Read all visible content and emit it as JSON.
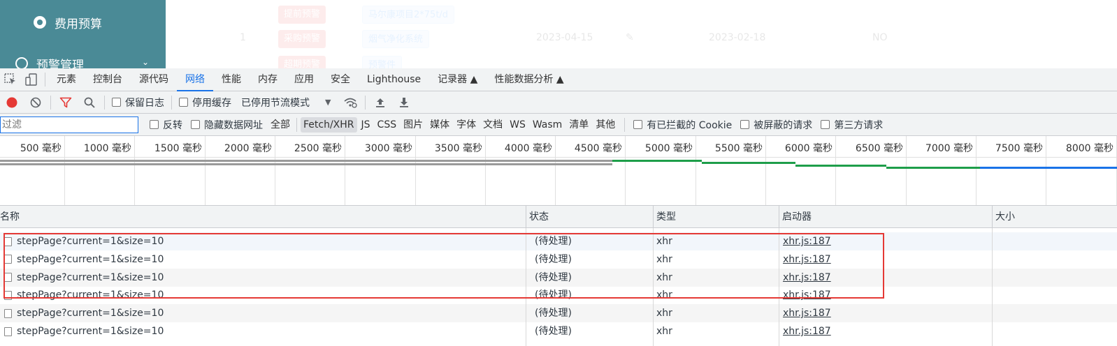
{
  "app": {
    "sidebar": {
      "budget_label": "费用预算",
      "warning_label": "预警管理",
      "chevron": "⌄"
    },
    "faded_row": {
      "tags_red": [
        "提前预警",
        "采购预警",
        "超期预警"
      ],
      "tags_blue": [
        "马尔康项目2*75t/d",
        "烟气净化系统",
        "预警件"
      ],
      "index": "1",
      "date1": "2023-04-15",
      "date2": "2023-02-18",
      "status": "NO"
    }
  },
  "devtools": {
    "tabs": [
      {
        "label": "元素"
      },
      {
        "label": "控制台"
      },
      {
        "label": "源代码"
      },
      {
        "label": "网络",
        "active": true
      },
      {
        "label": "性能"
      },
      {
        "label": "内存"
      },
      {
        "label": "应用"
      },
      {
        "label": "安全"
      },
      {
        "label": "Lighthouse"
      },
      {
        "label": "记录器 ▲"
      },
      {
        "label": "性能数据分析 ▲"
      }
    ],
    "toolbar": {
      "preserve_log": "保留日志",
      "disable_cache": "停用缓存",
      "throttling": "已停用节流模式",
      "throttling_arrow": "▼"
    },
    "filter": {
      "placeholder": "过滤",
      "invert": "反转",
      "hide_data_urls": "隐藏数据网址",
      "types": [
        "全部",
        "Fetch/XHR",
        "JS",
        "CSS",
        "图片",
        "媒体",
        "字体",
        "文档",
        "WS",
        "Wasm",
        "清单",
        "其他"
      ],
      "active_type": "Fetch/XHR",
      "blocked_cookies": "有已拦截的 Cookie",
      "blocked_requests": "被屏蔽的请求",
      "third_party": "第三方请求"
    },
    "timeline": {
      "ticks": [
        "500 毫秒",
        "1000 毫秒",
        "1500 毫秒",
        "2000 毫秒",
        "2500 毫秒",
        "3000 毫秒",
        "3500 毫秒",
        "4000 毫秒",
        "4500 毫秒",
        "5000 毫秒",
        "5500 毫秒",
        "6000 毫秒",
        "6500 毫秒",
        "7000 毫秒",
        "7500 毫秒",
        "8000 毫秒"
      ],
      "colors": {
        "gray": "#9a9a9a",
        "green": "#1e9e4a",
        "blue": "#1a73e8"
      }
    },
    "table": {
      "headers": [
        "名称",
        "状态",
        "类型",
        "启动器",
        "大小"
      ],
      "rows": [
        {
          "name": "stepPage?current=1&size=10",
          "status": "(待处理)",
          "type": "xhr",
          "initiator": "xhr.js:187"
        },
        {
          "name": "stepPage?current=1&size=10",
          "status": "(待处理)",
          "type": "xhr",
          "initiator": "xhr.js:187"
        },
        {
          "name": "stepPage?current=1&size=10",
          "status": "(待处理)",
          "type": "xhr",
          "initiator": "xhr.js:187"
        },
        {
          "name": "stepPage?current=1&size=10",
          "status": "(待处理)",
          "type": "xhr",
          "initiator": "xhr.js:187"
        },
        {
          "name": "stepPage?current=1&size=10",
          "status": "(待处理)",
          "type": "xhr",
          "initiator": "xhr.js:187"
        },
        {
          "name": "stepPage?current=1&size=10",
          "status": "(待处理)",
          "type": "xhr",
          "initiator": "xhr.js:187"
        }
      ],
      "highlight_color": "#e53935"
    }
  }
}
